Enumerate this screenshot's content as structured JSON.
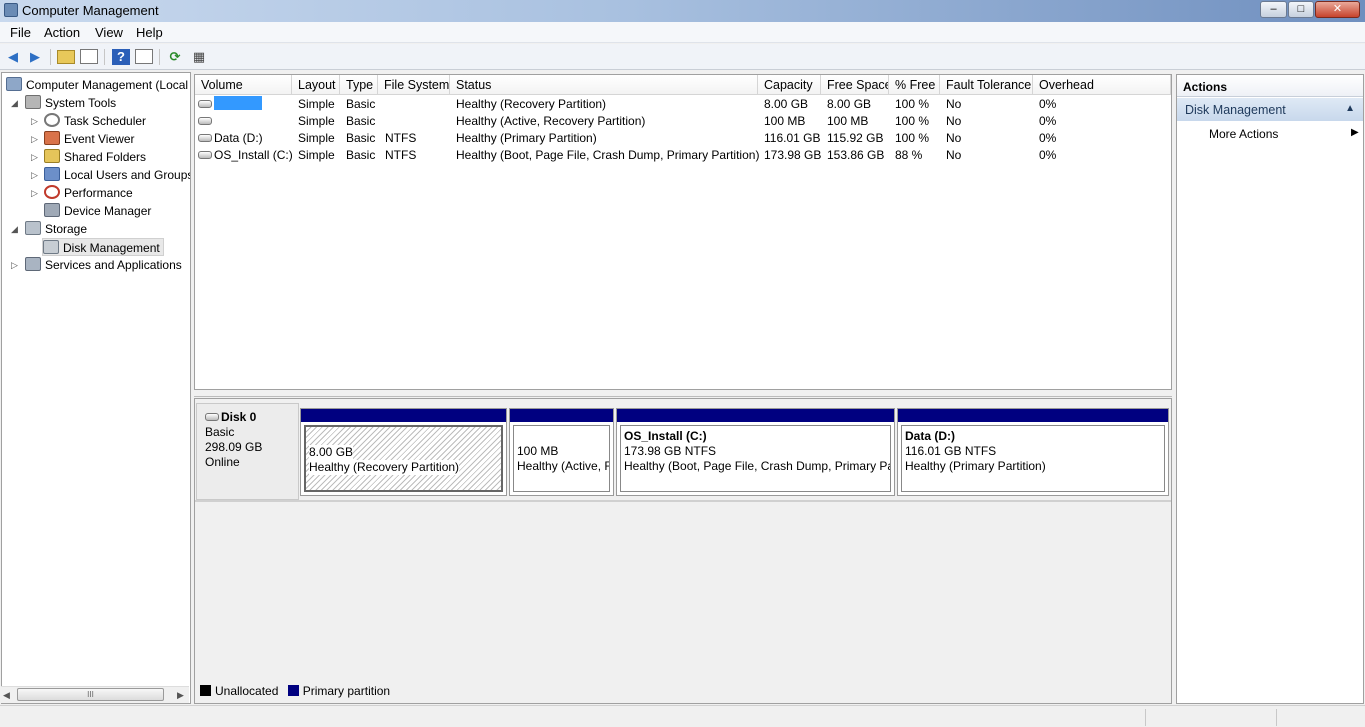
{
  "window": {
    "title": "Computer Management",
    "min": "–",
    "max": "□",
    "close": "✕"
  },
  "menu": [
    "File",
    "Action",
    "View",
    "Help"
  ],
  "tree": {
    "root": "Computer Management (Local",
    "system_tools": "System Tools",
    "task_scheduler": "Task Scheduler",
    "event_viewer": "Event Viewer",
    "shared_folders": "Shared Folders",
    "local_users": "Local Users and Groups",
    "performance": "Performance",
    "device_manager": "Device Manager",
    "storage": "Storage",
    "disk_management": "Disk Management",
    "services": "Services and Applications",
    "scroll_grip": "III"
  },
  "table": {
    "columns": [
      "Volume",
      "Layout",
      "Type",
      "File System",
      "Status",
      "Capacity",
      "Free Space",
      "% Free",
      "Fault Tolerance",
      "Overhead"
    ],
    "rows": [
      [
        "",
        "Simple",
        "Basic",
        "",
        "Healthy (Recovery Partition)",
        "8.00 GB",
        "8.00 GB",
        "100 %",
        "No",
        "0%"
      ],
      [
        "",
        "Simple",
        "Basic",
        "",
        "Healthy (Active, Recovery Partition)",
        "100 MB",
        "100 MB",
        "100 %",
        "No",
        "0%"
      ],
      [
        "Data (D:)",
        "Simple",
        "Basic",
        "NTFS",
        "Healthy (Primary Partition)",
        "116.01 GB",
        "115.92 GB",
        "100 %",
        "No",
        "0%"
      ],
      [
        "OS_Install (C:)",
        "Simple",
        "Basic",
        "NTFS",
        "Healthy (Boot, Page File, Crash Dump, Primary Partition)",
        "173.98 GB",
        "153.86 GB",
        "88 %",
        "No",
        "0%"
      ]
    ]
  },
  "disk": {
    "name": "Disk 0",
    "type": "Basic",
    "size": "298.09 GB",
    "state": "Online",
    "partitions": [
      {
        "title": "",
        "size": "8.00 GB",
        "status": "Healthy (Recovery Partition)"
      },
      {
        "title": "",
        "size": "100 MB",
        "status": "Healthy (Active, R"
      },
      {
        "title": "OS_Install  (C:)",
        "size": "173.98 GB NTFS",
        "status": "Healthy (Boot, Page File, Crash Dump, Primary Par"
      },
      {
        "title": "Data  (D:)",
        "size": "116.01 GB NTFS",
        "status": "Healthy (Primary Partition)"
      }
    ]
  },
  "legend": {
    "unallocated": "Unallocated",
    "primary": "Primary partition",
    "unallocated_color": "#000000",
    "primary_color": "#000080"
  },
  "actions": {
    "header": "Actions",
    "section": "Disk Management",
    "more": "More Actions"
  },
  "colors": {
    "selection_highlight": "#3399ff",
    "partition_header": "#000080"
  }
}
